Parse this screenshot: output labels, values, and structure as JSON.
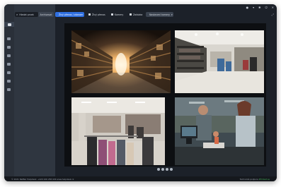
{
  "search": {
    "placeholder": "Hledat prvek"
  },
  "archive_button": {
    "label": "Archivovat"
  },
  "tabs": [
    {
      "label": "Živý přenos / záznam",
      "active": true
    },
    {
      "label": "Živý přenos",
      "active": false
    },
    {
      "label": "Kamery",
      "active": false
    },
    {
      "label": "Zakázka",
      "active": false
    },
    {
      "label": "Nastavení kamery",
      "active": false,
      "dropdown": true
    }
  ],
  "header_icons": [
    "user-icon",
    "download-icon",
    "settings-icon",
    "power-icon",
    "close-icon"
  ],
  "sidebar_icons": [
    "camera-icon",
    "folder-icon",
    "grid-icon",
    "list-icon",
    "clock-icon",
    "alert-icon",
    "user-icon",
    "exit-icon"
  ],
  "cameras": [
    {
      "name": "warehouse-aisle"
    },
    {
      "name": "clothing-store-interior"
    },
    {
      "name": "shopping-mall-store"
    },
    {
      "name": "checkout-counter"
    }
  ],
  "status": {
    "left": "© 2021 NetBar   Helpdesk: +420 226 258 029   www.helpdesk.cz",
    "right_prefix": "Technická podpora",
    "right_link": "Přihlásit se"
  },
  "colors": {
    "accent": "#2f6fe0",
    "frame": "#1c2129",
    "panel": "#2f3640",
    "link": "#46b35a"
  }
}
